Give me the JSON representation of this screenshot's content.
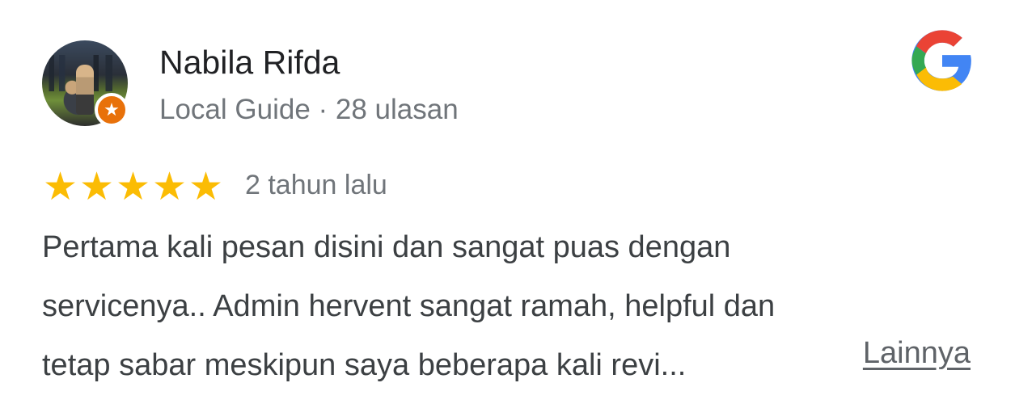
{
  "reviewer": {
    "name": "Nabila Rifda",
    "meta": "Local Guide · 28 ulasan",
    "badge_icon": "star-badge-icon",
    "badge_color": "#e8710a"
  },
  "brand": {
    "logo": "google-g-icon",
    "colors": [
      "#4285f4",
      "#ea4335",
      "#fbbc05",
      "#34a853"
    ]
  },
  "review": {
    "rating": 5,
    "rating_max": 5,
    "star_color": "#fbbc04",
    "date": "2 tahun lalu",
    "lines": [
      "Pertama kali pesan disini dan sangat puas dengan",
      "servicenya.. Admin hervent sangat ramah, helpful dan",
      "tetap sabar meskipun saya beberapa kali revi..."
    ],
    "more_label": "Lainnya"
  }
}
